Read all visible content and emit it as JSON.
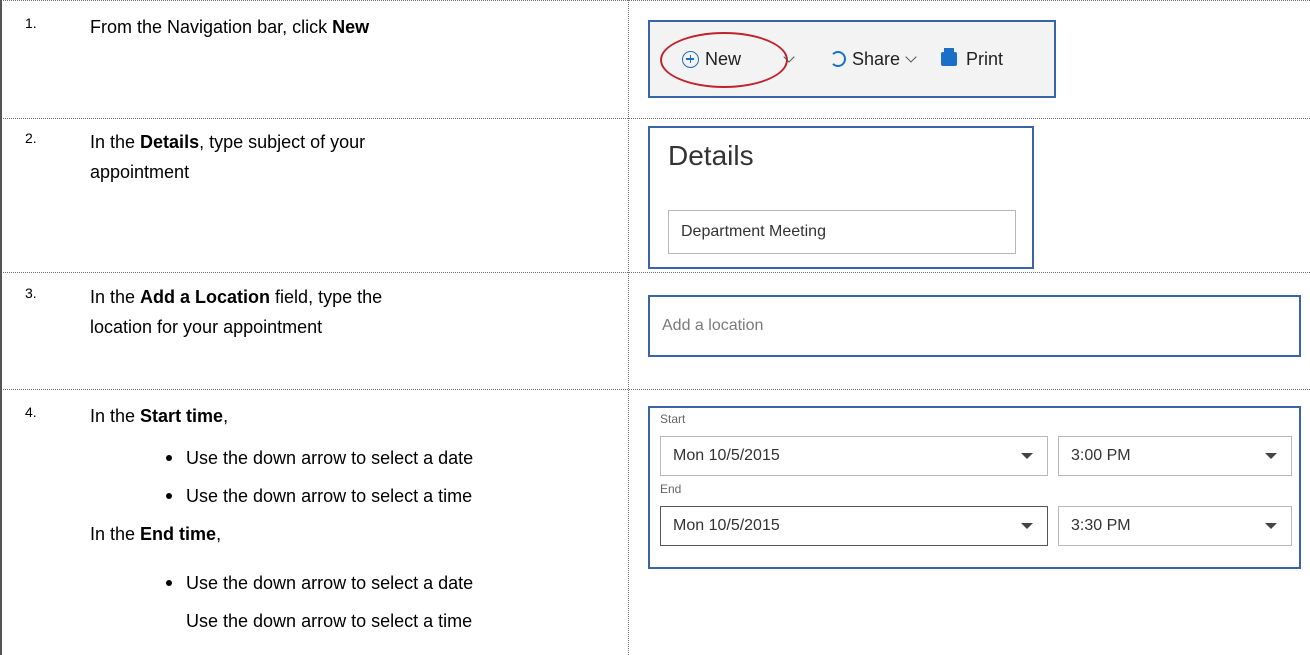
{
  "steps": [
    {
      "num": "1.",
      "text_before": "From the Navigation bar, click ",
      "text_bold": "New",
      "text_after": ""
    },
    {
      "num": "2.",
      "text_before": "In the ",
      "text_bold": "Details",
      "text_after": ", type subject of your",
      "line2": "appointment"
    },
    {
      "num": "3.",
      "text_before": "In the ",
      "text_bold": "Add a Location",
      "text_after": " field, type the",
      "line2": "location for your appointment"
    },
    {
      "num": "4.",
      "text_before": "In the ",
      "text_bold": "Start time",
      "text_after": ",",
      "bullets_start": [
        "Use the down arrow to select a date",
        "Use the down arrow to select a time"
      ],
      "end_before": "In the ",
      "end_bold": "End time",
      "end_after": ",",
      "bullets_end": [
        "Use the down arrow to select a date"
      ],
      "last_line": "Use the down arrow to select a time"
    }
  ],
  "nav": {
    "new_label": "New",
    "share_label": "Share",
    "print_label": "Print",
    "icons": [
      "plus-circle-icon",
      "chevron-down-icon",
      "share-icon",
      "print-icon"
    ],
    "highlight_color": "#c0232d"
  },
  "details": {
    "title": "Details",
    "subject_value": "Department Meeting"
  },
  "location": {
    "placeholder": "Add a location"
  },
  "datetime": {
    "start_label": "Start",
    "start_date": "Mon 10/5/2015",
    "start_time": "3:00 PM",
    "end_label": "End",
    "end_date": "Mon 10/5/2015",
    "end_time": "3:30 PM"
  },
  "colors": {
    "frame_border": "#3a64a8",
    "icon_blue": "#1b6fc7"
  }
}
